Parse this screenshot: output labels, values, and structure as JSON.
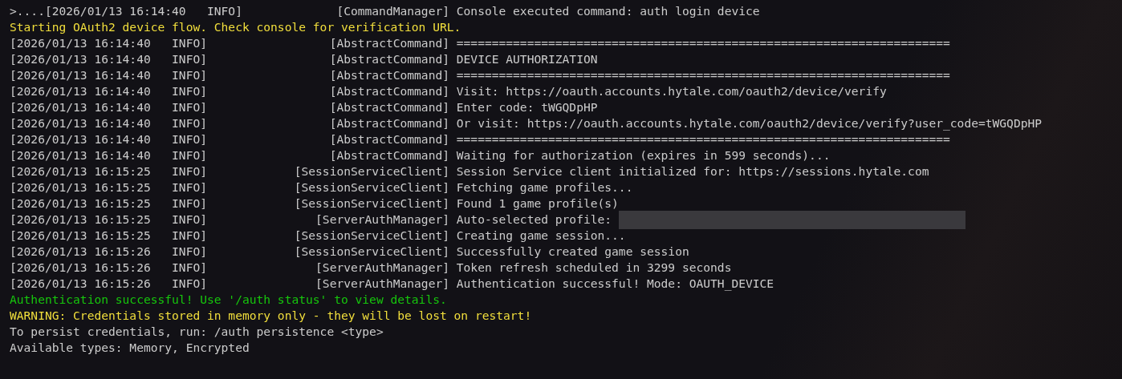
{
  "console": {
    "lines": [
      {
        "kind": "log",
        "timestamp": ">....[2026/01/13 16:14:40",
        "level": "INFO]",
        "source": "[CommandManager]",
        "message": "Console executed command: auth login device"
      },
      {
        "kind": "plain",
        "color": "#f2df3c",
        "text": "Starting OAuth2 device flow. Check console for verification URL."
      },
      {
        "kind": "log",
        "timestamp": "[2026/01/13 16:14:40",
        "level": "INFO]",
        "source": "[AbstractCommand]",
        "message": "======================================================================"
      },
      {
        "kind": "log",
        "timestamp": "[2026/01/13 16:14:40",
        "level": "INFO]",
        "source": "[AbstractCommand]",
        "message": "DEVICE AUTHORIZATION"
      },
      {
        "kind": "log",
        "timestamp": "[2026/01/13 16:14:40",
        "level": "INFO]",
        "source": "[AbstractCommand]",
        "message": "======================================================================"
      },
      {
        "kind": "log",
        "timestamp": "[2026/01/13 16:14:40",
        "level": "INFO]",
        "source": "[AbstractCommand]",
        "message": "Visit: https://oauth.accounts.hytale.com/oauth2/device/verify"
      },
      {
        "kind": "log",
        "timestamp": "[2026/01/13 16:14:40",
        "level": "INFO]",
        "source": "[AbstractCommand]",
        "message": "Enter code: tWGQDpHP"
      },
      {
        "kind": "log",
        "timestamp": "[2026/01/13 16:14:40",
        "level": "INFO]",
        "source": "[AbstractCommand]",
        "message": "Or visit: https://oauth.accounts.hytale.com/oauth2/device/verify?user_code=tWGQDpHP"
      },
      {
        "kind": "log",
        "timestamp": "[2026/01/13 16:14:40",
        "level": "INFO]",
        "source": "[AbstractCommand]",
        "message": "======================================================================"
      },
      {
        "kind": "log",
        "timestamp": "[2026/01/13 16:14:40",
        "level": "INFO]",
        "source": "[AbstractCommand]",
        "message": "Waiting for authorization (expires in 599 seconds)..."
      },
      {
        "kind": "log",
        "timestamp": "[2026/01/13 16:15:25",
        "level": "INFO]",
        "source": "[SessionServiceClient]",
        "message": "Session Service client initialized for: https://sessions.hytale.com"
      },
      {
        "kind": "log",
        "timestamp": "[2026/01/13 16:15:25",
        "level": "INFO]",
        "source": "[SessionServiceClient]",
        "message": "Fetching game profiles..."
      },
      {
        "kind": "log",
        "timestamp": "[2026/01/13 16:15:25",
        "level": "INFO]",
        "source": "[SessionServiceClient]",
        "message": "Found 1 game profile(s)"
      },
      {
        "kind": "log",
        "timestamp": "[2026/01/13 16:15:25",
        "level": "INFO]",
        "source": "[ServerAuthManager]",
        "message": "Auto-selected profile:",
        "redacted": true
      },
      {
        "kind": "log",
        "timestamp": "[2026/01/13 16:15:25",
        "level": "INFO]",
        "source": "[SessionServiceClient]",
        "message": "Creating game session..."
      },
      {
        "kind": "log",
        "timestamp": "[2026/01/13 16:15:26",
        "level": "INFO]",
        "source": "[SessionServiceClient]",
        "message": "Successfully created game session"
      },
      {
        "kind": "log",
        "timestamp": "[2026/01/13 16:15:26",
        "level": "INFO]",
        "source": "[ServerAuthManager]",
        "message": "Token refresh scheduled in 3299 seconds"
      },
      {
        "kind": "log",
        "timestamp": "[2026/01/13 16:15:26",
        "level": "INFO]",
        "source": "[ServerAuthManager]",
        "message": "Authentication successful! Mode: OAUTH_DEVICE"
      },
      {
        "kind": "plain",
        "color": "#16c60c",
        "text": "Authentication successful! Use '/auth status' to view details."
      },
      {
        "kind": "plain",
        "color": "#f2df3c",
        "text": "WARNING: Credentials stored in memory only - they will be lost on restart!"
      },
      {
        "kind": "plain",
        "color": "#cccccc",
        "text": "To persist credentials, run: /auth persistence <type>"
      },
      {
        "kind": "plain",
        "color": "#cccccc",
        "text": "Available types: Memory, Encrypted"
      }
    ]
  }
}
